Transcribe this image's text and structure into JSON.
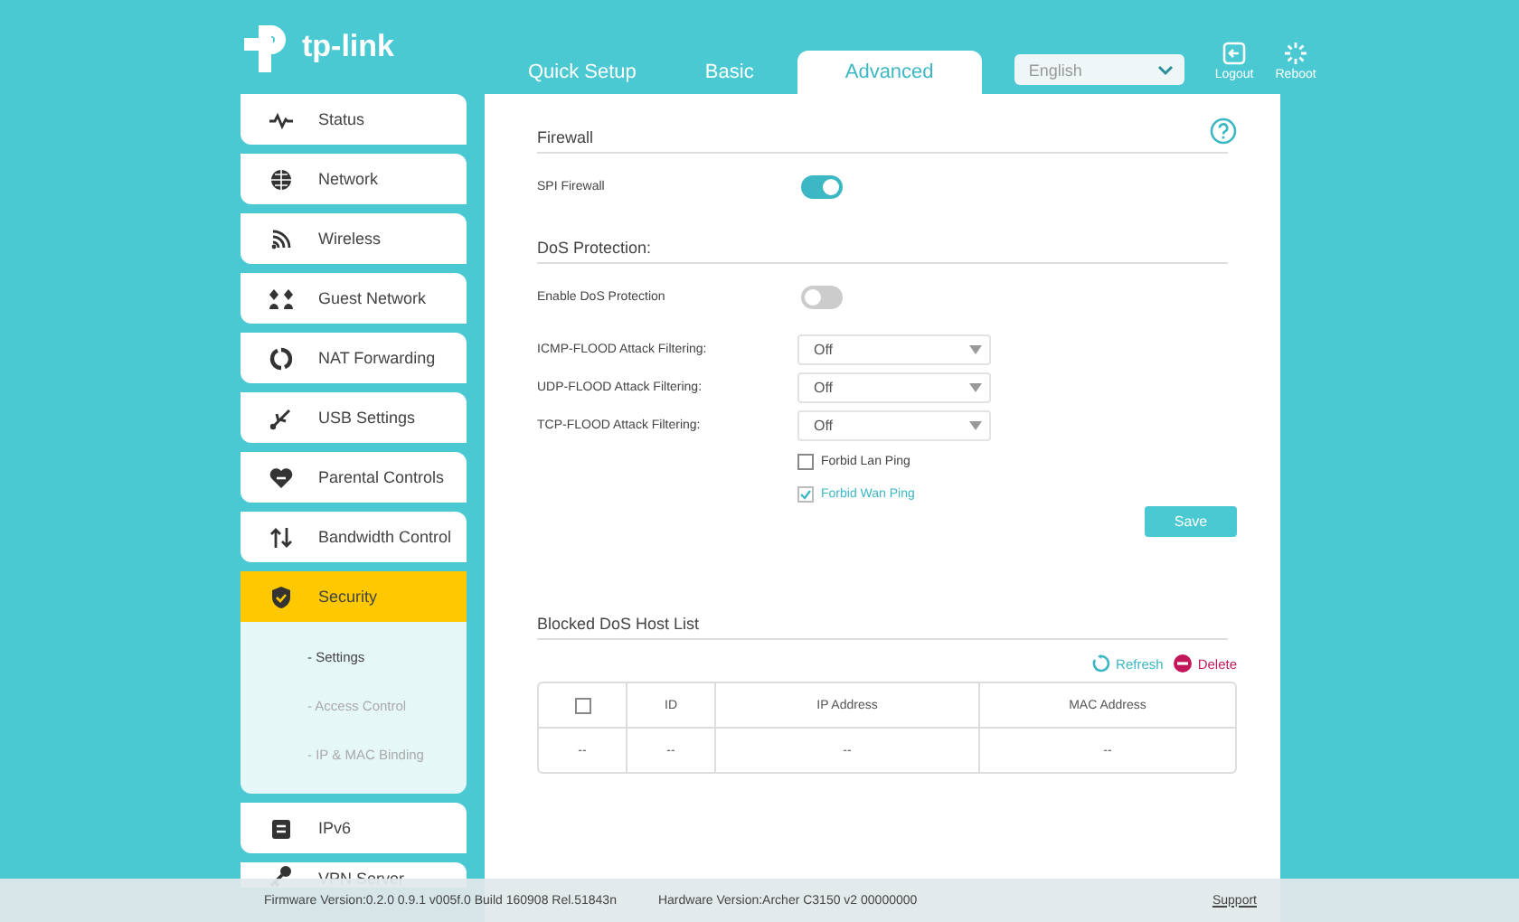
{
  "header": {
    "logo": "tp-link",
    "tabs": [
      {
        "label": "Quick Setup",
        "selected": false
      },
      {
        "label": "Basic",
        "selected": false
      },
      {
        "label": "Advanced",
        "selected": true
      }
    ],
    "language": "English",
    "actions": [
      {
        "kind": "logout",
        "label": "Logout"
      },
      {
        "kind": "reboot",
        "label": "Reboot"
      }
    ]
  },
  "sidebar": {
    "items": [
      {
        "label": "Status",
        "selected": false
      },
      {
        "label": "Network",
        "selected": false
      },
      {
        "label": "Wireless",
        "selected": false
      },
      {
        "label": "Guest Network",
        "selected": false
      },
      {
        "label": "NAT Forwarding",
        "selected": false
      },
      {
        "label": "USB Settings",
        "selected": false
      },
      {
        "label": "Parental Controls",
        "selected": false
      },
      {
        "label": "Bandwidth Control",
        "selected": false
      },
      {
        "label": "Security",
        "selected": true,
        "children": [
          {
            "label": "- Settings",
            "selected": true
          },
          {
            "label": "- Access Control",
            "selected": false
          },
          {
            "label": "- IP & MAC Binding",
            "selected": false
          }
        ]
      },
      {
        "label": "IPv6",
        "selected": false
      },
      {
        "label": "VPN Server",
        "selected": false
      }
    ]
  },
  "firewall": {
    "title": "Firewall",
    "settings": [
      {
        "label": "SPI Firewall",
        "on": true
      }
    ]
  },
  "dos": {
    "title": "DoS Protection:",
    "enable": {
      "label": "Enable DoS Protection",
      "on": false
    },
    "filters": [
      {
        "label": "ICMP-FLOOD Attack Filtering:",
        "value": "Off"
      },
      {
        "label": "UDP-FLOOD Attack Filtering:",
        "value": "Off"
      },
      {
        "label": "TCP-FLOOD Attack Filtering:",
        "value": "Off"
      }
    ],
    "options": [
      {
        "label": "Forbid Lan Ping",
        "checked": false
      },
      {
        "label": "Forbid Wan Ping",
        "checked": true
      }
    ],
    "save": "Save"
  },
  "blocked": {
    "title": "Blocked DoS Host List",
    "actions": [
      {
        "kind": "refresh",
        "label": "Refresh"
      },
      {
        "kind": "delete",
        "label": "Delete"
      }
    ],
    "columns": [
      {
        "kind": "checkbox",
        "checked": false
      },
      {
        "kind": "text",
        "label": "ID"
      },
      {
        "kind": "text",
        "label": "IP Address"
      },
      {
        "kind": "text",
        "label": "MAC Address"
      }
    ],
    "rows": [
      [
        "--",
        "--",
        "--",
        "--"
      ]
    ]
  },
  "footer": {
    "firmware": "Firmware Version:0.2.0 0.9.1 v005f.0 Build 160908 Rel.51843n",
    "hardware": "Hardware Version:Archer C3150 v2 00000000",
    "support": "Support"
  }
}
